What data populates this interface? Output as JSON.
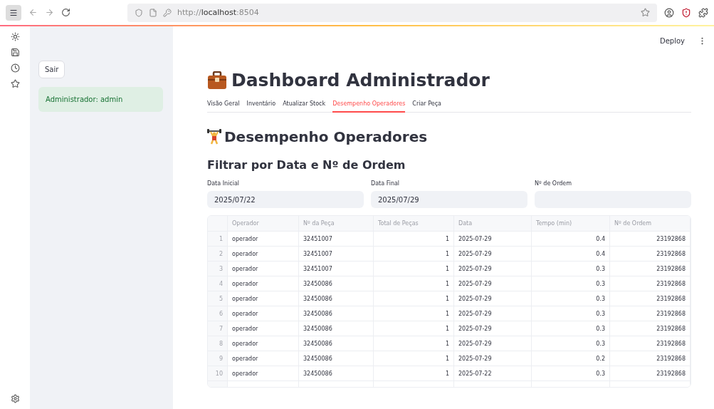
{
  "browser": {
    "url": "http://**localhost**:8504"
  },
  "sidebar": {
    "button": "Sair",
    "status": "Administrador: admin"
  },
  "header": {
    "action": "Deploy"
  },
  "title": "Dashboard Administrador",
  "tabs": [
    {
      "label": "Visão Geral",
      "selected": false
    },
    {
      "label": "Inventário",
      "selected": false
    },
    {
      "label": "Atualizar Stock",
      "selected": false
    },
    {
      "label": "Desempenho Operadores",
      "selected": true
    },
    {
      "label": "Criar Peça",
      "selected": false
    }
  ],
  "section_title": "Desempenho Operadores",
  "filter_title": "Filtrar por Data e Nº de Ordem",
  "filters": [
    {
      "label": "Data Inicial",
      "value": "2025/07/22"
    },
    {
      "label": "Data Final",
      "value": "2025/07/29"
    },
    {
      "label": "Nº de Ordem"
    }
  ],
  "table": {
    "columns": [
      {
        "label": "Operador",
        "kind": "text"
      },
      {
        "label": "Nº da Peça",
        "kind": "text"
      },
      {
        "label": "Total de Peças",
        "kind": "number"
      },
      {
        "label": "Data",
        "kind": "text"
      },
      {
        "label": "Tempo (min)",
        "kind": "number"
      },
      {
        "label": "Nº de Ordem",
        "kind": "number"
      }
    ],
    "rows": [
      {
        "index": "1",
        "cells": [
          "operador",
          "32451007",
          "1",
          "2025-07-29",
          "0.4",
          "23192868"
        ]
      },
      {
        "index": "2",
        "cells": [
          "operador",
          "32451007",
          "1",
          "2025-07-29",
          "0.4",
          "23192868"
        ]
      },
      {
        "index": "3",
        "cells": [
          "operador",
          "32451007",
          "1",
          "2025-07-29",
          "0.3",
          "23192868"
        ]
      },
      {
        "index": "4",
        "cells": [
          "operador",
          "32450086",
          "1",
          "2025-07-29",
          "0.3",
          "23192868"
        ]
      },
      {
        "index": "5",
        "cells": [
          "operador",
          "32450086",
          "1",
          "2025-07-29",
          "0.3",
          "23192868"
        ]
      },
      {
        "index": "6",
        "cells": [
          "operador",
          "32450086",
          "1",
          "2025-07-29",
          "0.3",
          "23192868"
        ]
      },
      {
        "index": "7",
        "cells": [
          "operador",
          "32450086",
          "1",
          "2025-07-29",
          "0.3",
          "23192868"
        ]
      },
      {
        "index": "8",
        "cells": [
          "operador",
          "32450086",
          "1",
          "2025-07-29",
          "0.3",
          "23192868"
        ]
      },
      {
        "index": "9",
        "cells": [
          "operador",
          "32450086",
          "1",
          "2025-07-29",
          "0.2",
          "23192868"
        ]
      },
      {
        "index": "10",
        "cells": [
          "operador",
          "32450086",
          "1",
          "2025-07-22",
          "0.3",
          "23192868"
        ]
      }
    ]
  }
}
